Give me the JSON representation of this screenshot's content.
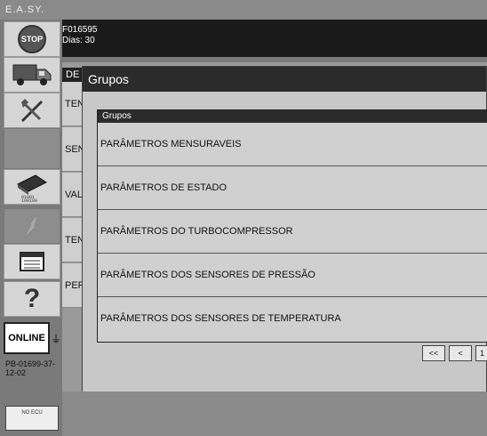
{
  "app": {
    "title": "E.A.SY."
  },
  "info": {
    "vehicle_id": "F016595",
    "days": "Dias: 30"
  },
  "sidebar": {
    "stop_label": "STOP",
    "online_label": "ONLINE",
    "ecu_id": "PB-01699-37-12-02",
    "no_ecu_label": "NO ECU",
    "icons": [
      "stop-icon",
      "truck-icon",
      "tools-icon",
      "ecu-icon",
      "diagnostics-icon",
      "report-icon",
      "help-icon"
    ]
  },
  "background": {
    "header": "DE",
    "items": [
      "TEN",
      "SEN",
      "VAL",
      "TEN",
      "PER"
    ]
  },
  "modal": {
    "title": "Grupos",
    "list_header": "Grupos",
    "rows": [
      "PARÂMETROS MENSURAVEIS",
      "PARÂMETROS DE ESTADO",
      "PARÂMETROS DO TURBOCOMPRESSOR",
      "PARÂMETROS DOS SENSORES DE PRESSÃO",
      "PARÂMETROS DOS SENSORES DE TEMPERATURA"
    ],
    "pager": {
      "first": "<<",
      "prev": "<",
      "page": "1"
    }
  }
}
